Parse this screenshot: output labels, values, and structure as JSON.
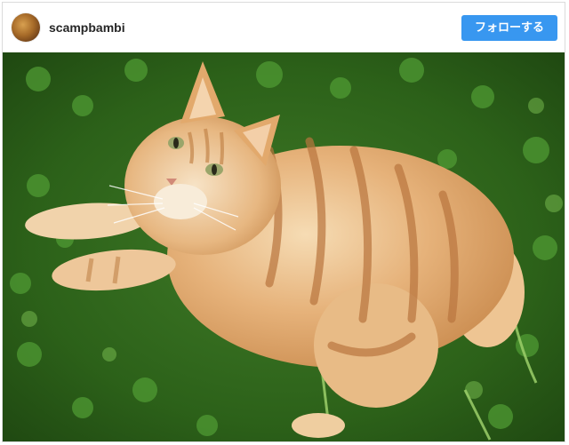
{
  "post": {
    "username": "scampbambi",
    "follow_label": "フォローする",
    "photo_icon": "cat-photo",
    "colors": {
      "follow_button": "#3897f0",
      "username": "#262626",
      "grass": "#2f6a1f"
    }
  }
}
